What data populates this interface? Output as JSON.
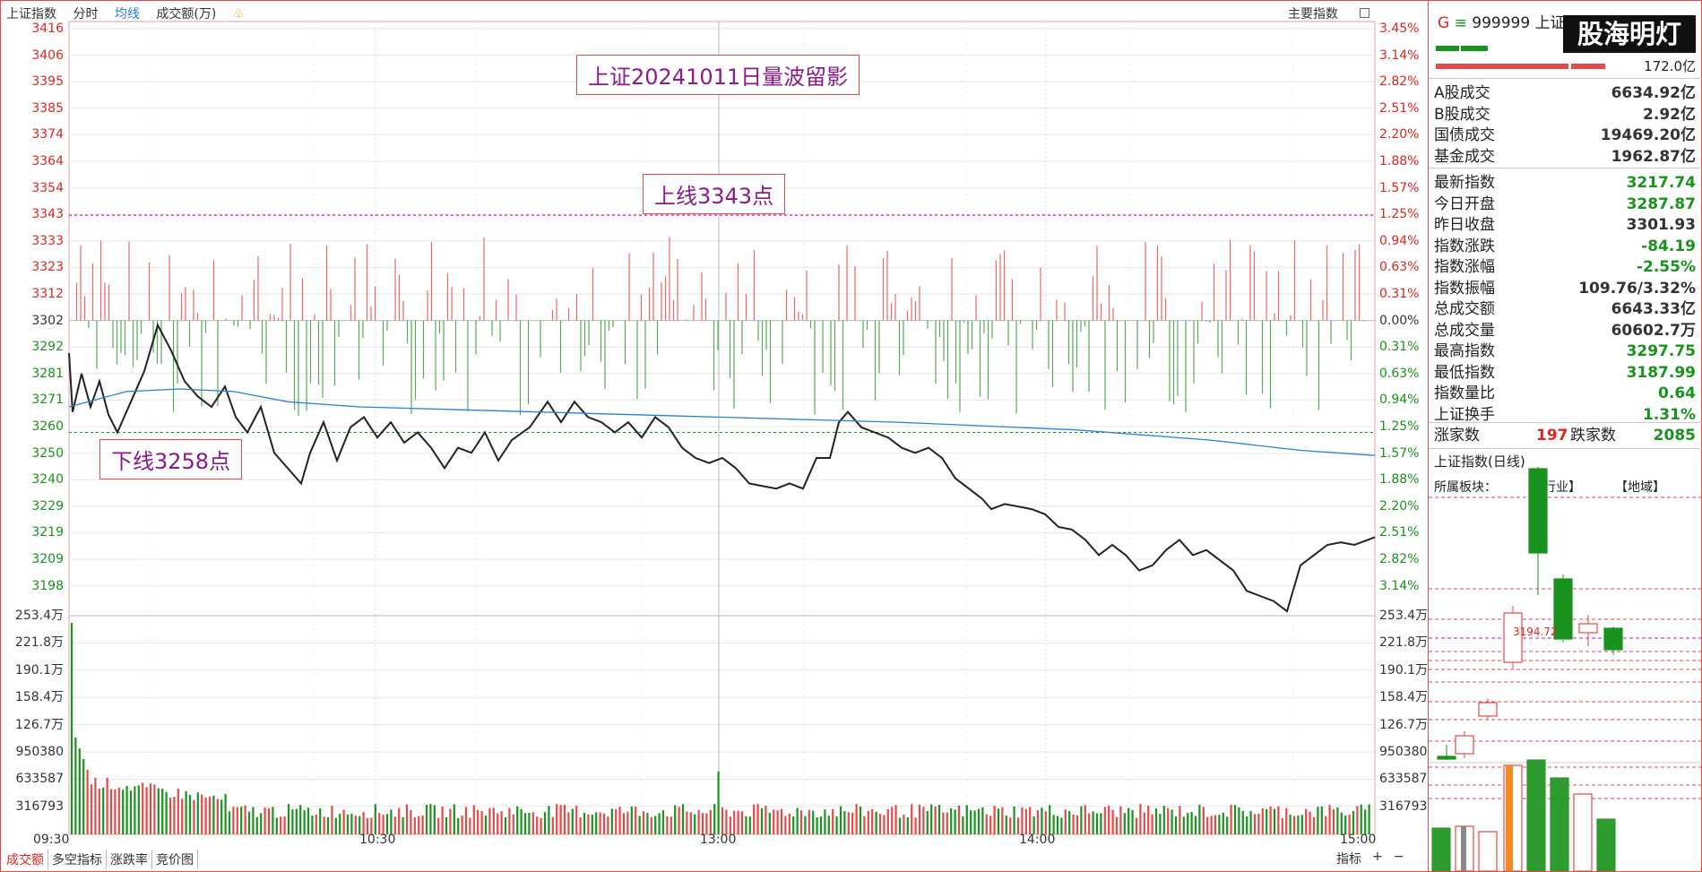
{
  "header": {
    "index_name": "上证指数",
    "tabs": [
      "分时",
      "均线",
      "成交额(万)"
    ],
    "active_tab": "均线",
    "main_indicator": "主要指数"
  },
  "annotations": {
    "title": "上证20241011日量波留影",
    "upper_line": "上线3343点",
    "lower_line": "下线3258点"
  },
  "price_axis": {
    "left": [
      "3416",
      "3406",
      "3395",
      "3385",
      "3374",
      "3364",
      "3354",
      "3343",
      "3333",
      "3323",
      "3312",
      "3302",
      "3292",
      "3281",
      "3271",
      "3260",
      "3250",
      "3240",
      "3229",
      "3219",
      "3209",
      "3198"
    ],
    "right": [
      "3.45%",
      "3.14%",
      "2.82%",
      "2.51%",
      "2.20%",
      "1.88%",
      "1.57%",
      "1.25%",
      "0.94%",
      "0.63%",
      "0.31%",
      "0.00%",
      "0.31%",
      "0.63%",
      "0.94%",
      "1.25%",
      "1.57%",
      "1.88%",
      "2.20%",
      "2.51%",
      "2.82%",
      "3.14%"
    ]
  },
  "volume_axis": [
    "253.4万",
    "221.8万",
    "190.1万",
    "158.4万",
    "126.7万",
    "950380",
    "633587",
    "316793"
  ],
  "time_axis": [
    "09:30",
    "10:30",
    "13:00",
    "14:00",
    "15:00"
  ],
  "bottom_tabs": [
    "成交额",
    "多空指标",
    "涨跌率",
    "竞价图"
  ],
  "bottom_right": [
    "指标",
    "+",
    "−"
  ],
  "right_panel": {
    "code_prefix": "G",
    "code": "999999",
    "name_short": "上证",
    "watermark": "股海明灯",
    "volume_total": "172.0亿",
    "stats": [
      {
        "label": "A股成交",
        "value": "6634.92亿",
        "color": "dark"
      },
      {
        "label": "B股成交",
        "value": "2.92亿",
        "color": "dark"
      },
      {
        "label": "国债成交",
        "value": "19469.20亿",
        "color": "dark"
      },
      {
        "label": "基金成交",
        "value": "1962.87亿",
        "color": "dark"
      },
      {
        "label": "最新指数",
        "value": "3217.74",
        "color": "green"
      },
      {
        "label": "今日开盘",
        "value": "3287.87",
        "color": "green"
      },
      {
        "label": "昨日收盘",
        "value": "3301.93",
        "color": "dark"
      },
      {
        "label": "指数涨跌",
        "value": "-84.19",
        "color": "green"
      },
      {
        "label": "指数涨幅",
        "value": "-2.55%",
        "color": "green"
      },
      {
        "label": "指数振幅",
        "value": "109.76/3.32%",
        "color": "dark"
      },
      {
        "label": "总成交额",
        "value": "6643.33亿",
        "color": "dark"
      },
      {
        "label": "总成交量",
        "value": "60602.7万",
        "color": "dark"
      },
      {
        "label": "最高指数",
        "value": "3297.75",
        "color": "green"
      },
      {
        "label": "最低指数",
        "value": "3187.99",
        "color": "green"
      },
      {
        "label": "指数量比",
        "value": "0.64",
        "color": "green"
      },
      {
        "label": "上证换手",
        "value": "1.31%",
        "color": "green"
      }
    ],
    "up_label": "涨家数",
    "up_count": "197",
    "down_label": "跌家数",
    "down_count": "2085",
    "daily_title": "上证指数(日线)",
    "sector_label": "所属板块：",
    "industry": "【行业】",
    "region": "【地域】",
    "price_mark": "3194.72"
  }
}
